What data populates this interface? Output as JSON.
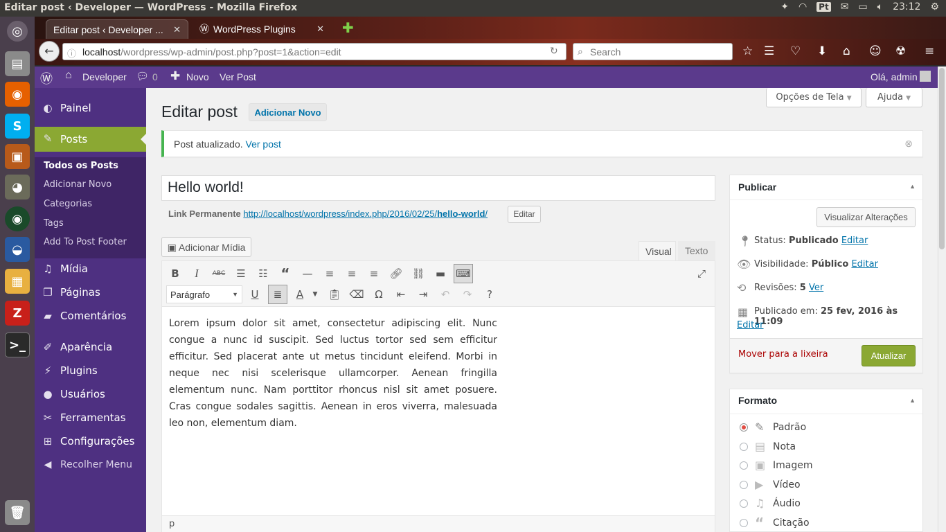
{
  "window_title": "Editar post ‹ Developer — WordPress - Mozilla Firefox",
  "tray": {
    "lang": "Pt",
    "time": "23:12"
  },
  "browser": {
    "tabs": [
      {
        "label": "Editar post ‹ Developer ..."
      },
      {
        "label": "WordPress Plugins"
      }
    ],
    "url_host": "localhost",
    "url_path": "/wordpress/wp-admin/post.php?post=1&action=edit",
    "search_placeholder": "Search"
  },
  "adminbar": {
    "site": "Developer",
    "comments": "0",
    "new": "Novo",
    "view_post": "Ver Post",
    "greeting": "Olá, admin"
  },
  "menu": {
    "painel": "Painel",
    "posts": "Posts",
    "posts_sub": [
      "Todos os Posts",
      "Adicionar Novo",
      "Categorias",
      "Tags",
      "Add To Post Footer"
    ],
    "midia": "Mídia",
    "paginas": "Páginas",
    "comentarios": "Comentários",
    "aparencia": "Aparência",
    "plugins": "Plugins",
    "usuarios": "Usuários",
    "ferramentas": "Ferramentas",
    "configuracoes": "Configurações",
    "recolher": "Recolher Menu"
  },
  "screen_options": "Opções de Tela",
  "help": "Ajuda",
  "page_title": "Editar post",
  "add_new": "Adicionar Novo",
  "notice": {
    "text": "Post atualizado.",
    "link": "Ver post"
  },
  "post": {
    "title": "Hello world!",
    "permalink_label": "Link Permanente",
    "permalink_base": "http://localhost/wordpress/index.php/2016/02/25/",
    "permalink_slug": "hello-world",
    "permalink_end": "/",
    "permalink_edit": "Editar",
    "add_media": "Adicionar Mídia",
    "tab_visual": "Visual",
    "tab_text": "Texto",
    "format_select": "Parágrafo",
    "content": "Lorem ipsum dolor sit amet, consectetur adipiscing elit. Nunc congue a nunc id suscipit. Sed luctus tortor sed sem efficitur efficitur. Sed placerat ante ut metus tincidunt eleifend. Morbi in neque nec nisi scelerisque ullamcorper. Aenean fringilla elementum nunc. Nam porttitor rhoncus nisl sit amet posuere. Cras congue sodales sagittis. Aenean in eros viverra, malesuada leo non, elementum diam.",
    "path": "p"
  },
  "publish": {
    "title": "Publicar",
    "preview": "Visualizar Alterações",
    "status_label": "Status:",
    "status_value": "Publicado",
    "status_edit": "Editar",
    "visibility_label": "Visibilidade:",
    "visibility_value": "Público",
    "visibility_edit": "Editar",
    "revisions_label": "Revisões:",
    "revisions_value": "5",
    "revisions_link": "Ver",
    "published_label": "Publicado em:",
    "published_value": "25 fev, 2016 às 11:09",
    "published_edit": "Editar",
    "trash": "Mover para a lixeira",
    "update": "Atualizar"
  },
  "format": {
    "title": "Formato",
    "options": [
      "Padrão",
      "Nota",
      "Imagem",
      "Vídeo",
      "Áudio",
      "Citação"
    ]
  },
  "colors": {
    "admin_bar": "#5b3a8c",
    "sidebar": "#4e3081",
    "current_menu": "#8ba833",
    "update_button": "#8ba833",
    "link": "#0073aa"
  }
}
